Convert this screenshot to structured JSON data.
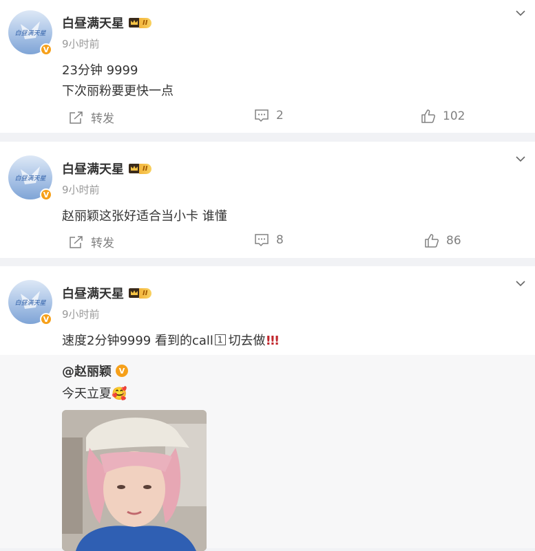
{
  "posts": [
    {
      "user": "白昼满天星",
      "vip_level": "II",
      "time": "9小时前",
      "lines": [
        "23分钟 9999",
        "下次丽粉要更快一点"
      ],
      "repost_label": "转发",
      "comments": "2",
      "likes": "102"
    },
    {
      "user": "白昼满天星",
      "vip_level": "II",
      "time": "9小时前",
      "lines": [
        "赵丽颖这张好适合当小卡 谁懂"
      ],
      "repost_label": "转发",
      "comments": "8",
      "likes": "86"
    },
    {
      "user": "白昼满天星",
      "vip_level": "II",
      "time": "9小时前",
      "text_main": "速度2分钟9999 看到的call",
      "text_boxed": "1",
      "text_tail": "切去做",
      "text_bangs": "!!!",
      "retweet": {
        "mention": "@赵丽颖",
        "text": "今天立夏",
        "emoji": "🥰"
      }
    }
  ],
  "avatar_text": "白昼满天星",
  "icons": {
    "chevron": "chevron-down-icon",
    "repost": "share-icon",
    "comment": "comment-icon",
    "like": "thumbs-up-icon",
    "verified": "verified-badge-icon",
    "crown": "crown-icon"
  },
  "colors": {
    "gold_badge": "#f6a01a",
    "text_primary": "#333333",
    "text_secondary": "#999999",
    "action_gray": "#808080",
    "divider": "#f1f2f5",
    "repost_bg": "#f7f7f8",
    "bang_red": "#c1272d"
  }
}
